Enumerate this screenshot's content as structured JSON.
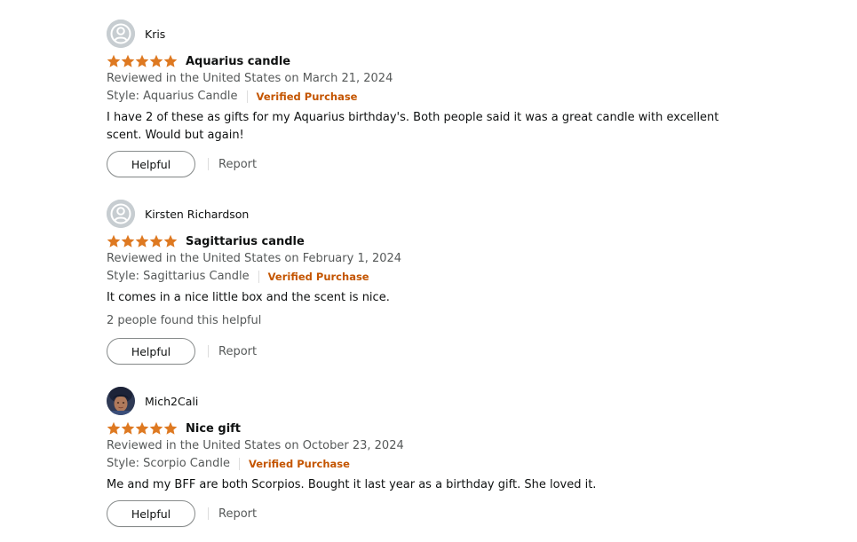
{
  "colors": {
    "star": "#de7921",
    "verified": "#c45500",
    "secondary_text": "#565959",
    "primary_text": "#0f1111",
    "avatar_placeholder": "#c7cdd1"
  },
  "review_ui": {
    "helpful_label": "Helpful",
    "report_label": "Report"
  },
  "reviews": [
    {
      "profile_name": "Kris",
      "avatar": "default-avatar-icon",
      "rating": 5,
      "title": "Aquarius candle",
      "date": "Reviewed in the United States on March 21, 2024",
      "style": "Style: Aquarius Candle",
      "verified": "Verified Purchase",
      "body_line1": "I have 2 of these as gifts for my Aquarius birthday's. Both people said it was a great candle with excellent",
      "body_line2": "scent. Would but again!",
      "helpful_count": ""
    },
    {
      "profile_name": "Kirsten Richardson",
      "avatar": "default-avatar-icon",
      "rating": 5,
      "title": "Sagittarius candle",
      "date": "Reviewed in the United States on February 1, 2024",
      "style": "Style: Sagittarius Candle",
      "verified": "Verified Purchase",
      "body_line1": "It comes in a nice little box and the scent is nice.",
      "body_line2": "",
      "helpful_count": "2 people found this helpful"
    },
    {
      "profile_name": "Mich2Cali",
      "avatar": "user-photo-avatar",
      "rating": 5,
      "title": "Nice gift",
      "date": "Reviewed in the United States on October 23, 2024",
      "style": "Style: Scorpio Candle",
      "verified": "Verified Purchase",
      "body_line1": "Me and my BFF are both Scorpios. Bought it last year as a birthday gift. She loved it.",
      "body_line2": "",
      "helpful_count": ""
    }
  ]
}
